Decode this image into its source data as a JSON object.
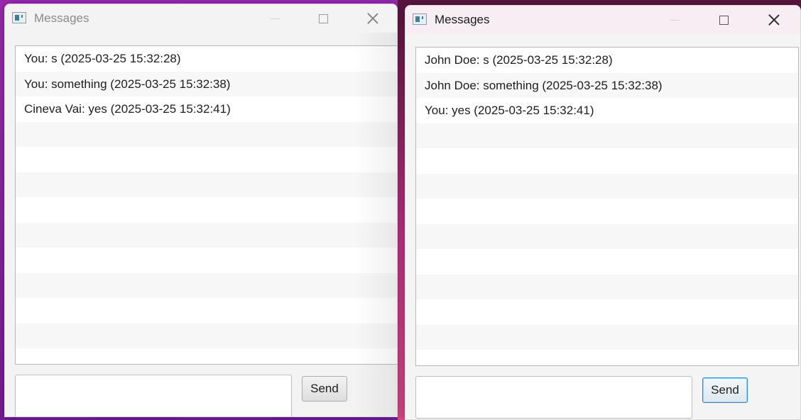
{
  "colors": {
    "accent": "#2a8fd6",
    "row_alt": "#f7f7f7"
  },
  "windows": [
    {
      "title": "Messages",
      "messages": [
        "You: s (2025-03-25 15:32:28)",
        "You: something (2025-03-25 15:32:38)",
        "Cineva Vai: yes (2025-03-25 15:32:41)"
      ],
      "input_value": "",
      "send_label": "Send"
    },
    {
      "title": "Messages",
      "messages": [
        "John Doe: s (2025-03-25 15:32:28)",
        "John Doe: something (2025-03-25 15:32:38)",
        "You: yes (2025-03-25 15:32:41)"
      ],
      "input_value": "",
      "send_label": "Send"
    }
  ]
}
